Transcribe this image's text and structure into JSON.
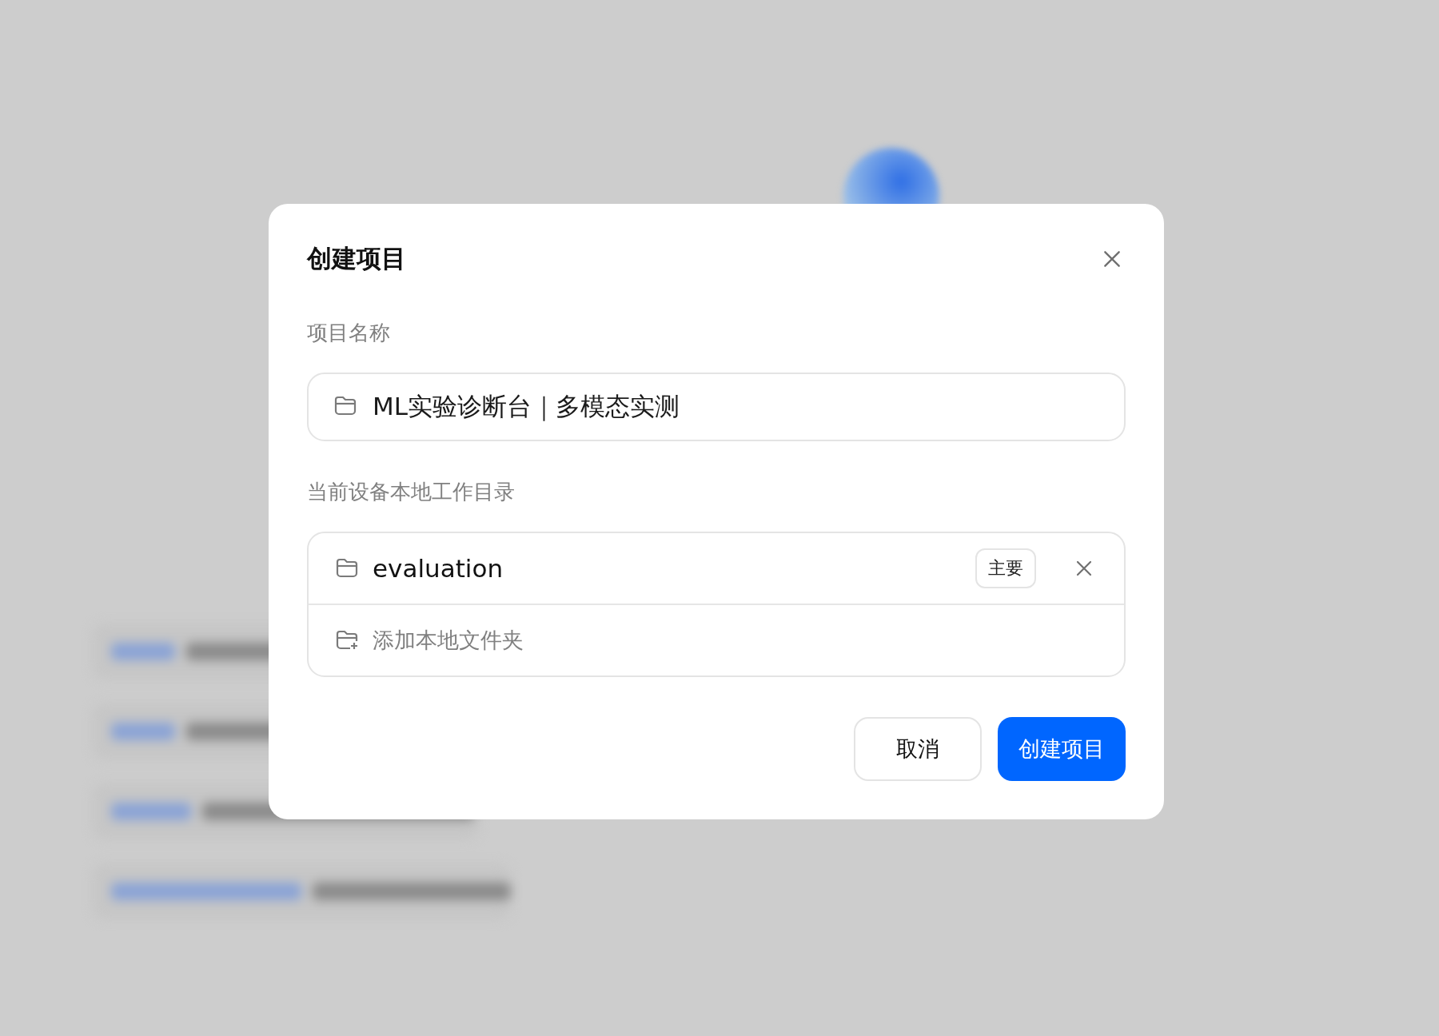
{
  "dialog": {
    "title": "创建项目",
    "name_field": {
      "label": "项目名称",
      "value": "ML实验诊断台｜多模态实测"
    },
    "directory": {
      "label": "当前设备本地工作目录",
      "folders": [
        {
          "name": "evaluation",
          "badge": "主要"
        }
      ],
      "add_label": "添加本地文件夹"
    },
    "buttons": [
      {
        "label": "取消",
        "kind": "secondary"
      },
      {
        "label": "创建项目",
        "kind": "primary"
      }
    ]
  }
}
